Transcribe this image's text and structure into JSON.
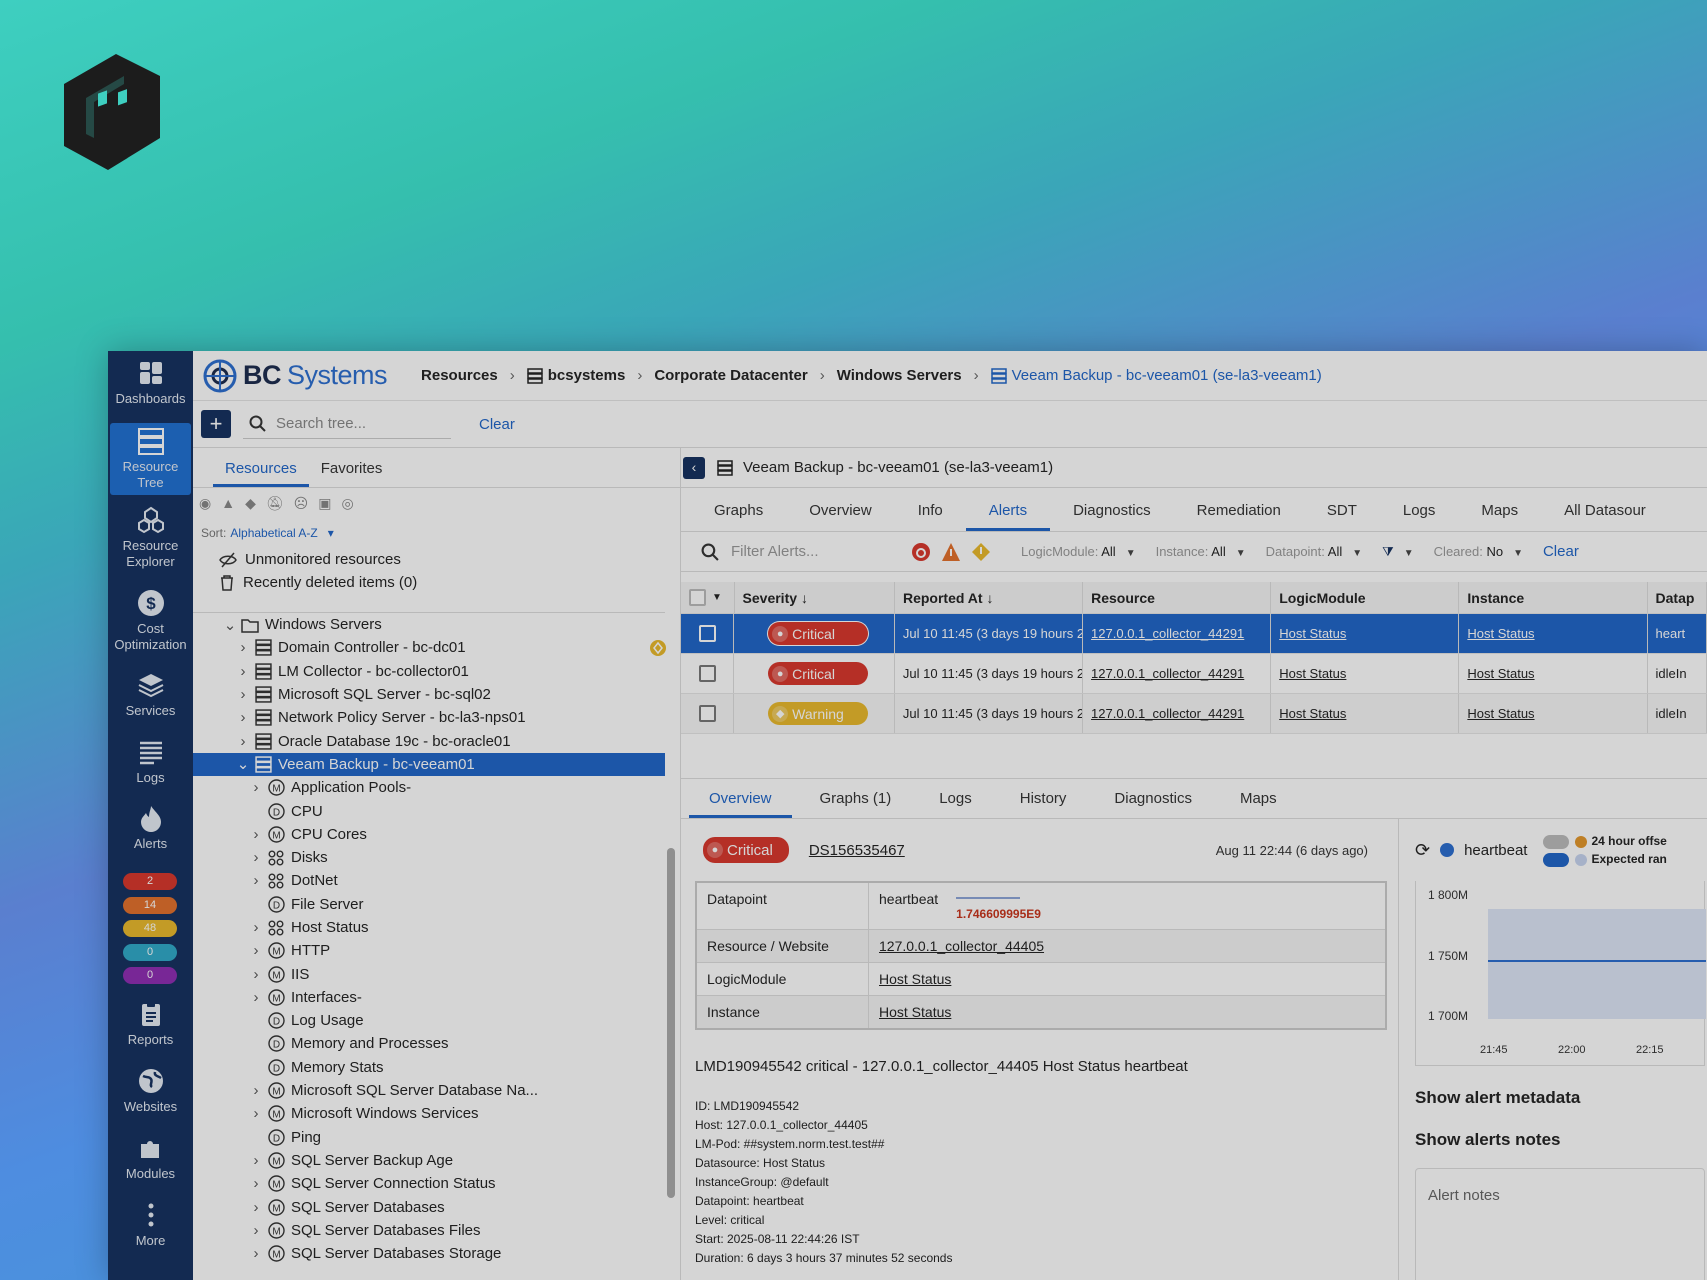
{
  "brand": {
    "name1": "BC",
    "name2": "Systems"
  },
  "breadcrumb": [
    "Resources",
    "bcsystems",
    "Corporate Datacenter",
    "Windows Servers",
    "Veeam Backup - bc-veeam01 (se-la3-veeam1)"
  ],
  "nav": [
    {
      "label": "Dashboards",
      "icon": "dashboard-icon"
    },
    {
      "label": "Resource Tree",
      "icon": "resource-tree-icon"
    },
    {
      "label": "Resource Explorer",
      "icon": "resource-explorer-icon"
    },
    {
      "label": "Cost Optimization",
      "icon": "dollar-icon"
    },
    {
      "label": "Services",
      "icon": "layers-icon"
    },
    {
      "label": "Logs",
      "icon": "logs-icon"
    },
    {
      "label": "Alerts",
      "icon": "flame-icon"
    },
    {
      "label": "Reports",
      "icon": "clipboard-icon"
    },
    {
      "label": "Websites",
      "icon": "globe-icon"
    },
    {
      "label": "Modules",
      "icon": "puzzle-icon"
    },
    {
      "label": "More",
      "icon": "more-vertical-icon"
    }
  ],
  "badges": [
    {
      "value": "2",
      "color": "#d8352a"
    },
    {
      "value": "14",
      "color": "#e3702a"
    },
    {
      "value": "48",
      "color": "#e9b92a"
    },
    {
      "value": "0",
      "color": "#2ea9c9"
    },
    {
      "value": "0",
      "color": "#8e2bb3"
    }
  ],
  "toolbar": {
    "search_placeholder": "Search tree...",
    "clear": "Clear"
  },
  "left_tabs": [
    "Resources",
    "Favorites"
  ],
  "sort": {
    "label": "Sort:",
    "value": "Alphabetical A-Z"
  },
  "special": [
    "Unmonitored resources",
    "Recently deleted items (0)"
  ],
  "tree": [
    {
      "label": "Windows Servers",
      "level": 0,
      "exp": "v",
      "icon": "folder"
    },
    {
      "label": "Domain Controller - bc-dc01",
      "level": 1,
      "exp": ">",
      "icon": "server",
      "badge": true
    },
    {
      "label": "LM Collector - bc-collector01",
      "level": 1,
      "exp": ">",
      "icon": "server"
    },
    {
      "label": "Microsoft SQL Server - bc-sql02",
      "level": 1,
      "exp": ">",
      "icon": "server"
    },
    {
      "label": "Network Policy Server - bc-la3-nps01",
      "level": 1,
      "exp": ">",
      "icon": "server"
    },
    {
      "label": "Oracle Database 19c - bc-oracle01",
      "level": 1,
      "exp": ">",
      "icon": "server"
    },
    {
      "label": "Veeam Backup - bc-veeam01",
      "level": 1,
      "exp": "v",
      "icon": "server",
      "sel": true
    },
    {
      "label": "Application Pools-",
      "level": 2,
      "exp": ">",
      "icon": "M"
    },
    {
      "label": "CPU",
      "level": 2,
      "exp": "",
      "icon": "D"
    },
    {
      "label": "CPU Cores",
      "level": 2,
      "exp": ">",
      "icon": "M"
    },
    {
      "label": "Disks",
      "level": 2,
      "exp": ">",
      "icon": "grid"
    },
    {
      "label": "DotNet",
      "level": 2,
      "exp": ">",
      "icon": "grid"
    },
    {
      "label": "File Server",
      "level": 2,
      "exp": "",
      "icon": "D"
    },
    {
      "label": "Host Status",
      "level": 2,
      "exp": ">",
      "icon": "grid"
    },
    {
      "label": "HTTP",
      "level": 2,
      "exp": ">",
      "icon": "M"
    },
    {
      "label": "IIS",
      "level": 2,
      "exp": ">",
      "icon": "M"
    },
    {
      "label": "Interfaces-",
      "level": 2,
      "exp": ">",
      "icon": "M"
    },
    {
      "label": "Log Usage",
      "level": 2,
      "exp": "",
      "icon": "D"
    },
    {
      "label": "Memory and Processes",
      "level": 2,
      "exp": "",
      "icon": "D"
    },
    {
      "label": "Memory Stats",
      "level": 2,
      "exp": "",
      "icon": "D"
    },
    {
      "label": "Microsoft SQL Server Database Na...",
      "level": 2,
      "exp": ">",
      "icon": "M"
    },
    {
      "label": "Microsoft Windows Services",
      "level": 2,
      "exp": ">",
      "icon": "M"
    },
    {
      "label": "Ping",
      "level": 2,
      "exp": "",
      "icon": "D"
    },
    {
      "label": "SQL Server Backup Age",
      "level": 2,
      "exp": ">",
      "icon": "M"
    },
    {
      "label": "SQL Server Connection Status",
      "level": 2,
      "exp": ">",
      "icon": "M"
    },
    {
      "label": "SQL Server Databases",
      "level": 2,
      "exp": ">",
      "icon": "M"
    },
    {
      "label": "SQL Server Databases Files",
      "level": 2,
      "exp": ">",
      "icon": "M"
    },
    {
      "label": "SQL Server Databases Storage",
      "level": 2,
      "exp": ">",
      "icon": "M"
    }
  ],
  "resource_title": "Veeam Backup - bc-veeam01 (se-la3-veeam1)",
  "resource_tabs": [
    "Graphs",
    "Overview",
    "Info",
    "Alerts",
    "Diagnostics",
    "Remediation",
    "SDT",
    "Logs",
    "Maps",
    "All Datasour"
  ],
  "alert_filter": {
    "placeholder": "Filter Alerts...",
    "logicmodule_label": "LogicModule:",
    "logicmodule": "All",
    "instance_label": "Instance:",
    "instance": "All",
    "datapoint_label": "Datapoint:",
    "datapoint": "All",
    "cleared_label": "Cleared:",
    "cleared": "No",
    "clear": "Clear"
  },
  "alert_columns": [
    "Severity",
    "Reported At",
    "Resource",
    "LogicModule",
    "Instance",
    "Datap"
  ],
  "alerts": [
    {
      "severity": "Critical",
      "reported": "Jul 10 11:45  (3 days 19 hours 2",
      "resource": "127.0.0.1_collector_44291",
      "module": "Host Status",
      "instance": "Host Status",
      "datapoint": "heart"
    },
    {
      "severity": "Critical",
      "reported": "Jul 10 11:45  (3 days 19 hours 2",
      "resource": "127.0.0.1_collector_44291",
      "module": "Host Status",
      "instance": "Host Status",
      "datapoint": "idleIn"
    },
    {
      "severity": "Warning",
      "reported": "Jul 10 11:45  (3 days 19 hours 2",
      "resource": "127.0.0.1_collector_44291",
      "module": "Host Status",
      "instance": "Host Status",
      "datapoint": "idleIn"
    }
  ],
  "detail_tabs": [
    "Overview",
    "Graphs (1)",
    "Logs",
    "History",
    "Diagnostics",
    "Maps"
  ],
  "detail": {
    "severity": "Critical",
    "ds": "DS156535467",
    "when": "Aug 11 22:44  (6 days ago)",
    "rows": [
      {
        "k": "Datapoint",
        "v": "heartbeat"
      },
      {
        "k": "Resource / Website",
        "v": "127.0.0.1_collector_44405"
      },
      {
        "k": "LogicModule",
        "v": "Host Status"
      },
      {
        "k": "Instance",
        "v": "Host Status"
      }
    ],
    "spark_value": "1.746609995E9",
    "message": "LMD190945542 critical - 127.0.0.1_collector_44405 Host Status heartbeat",
    "meta": [
      "ID: LMD190945542",
      "Host: 127.0.0.1_collector_44405",
      "LM-Pod: ##system.norm.test.test##",
      "Datasource: Host Status",
      "InstanceGroup: @default",
      "Datapoint: heartbeat",
      "Level: critical",
      "Start: 2025-08-11 22:44:26 IST",
      "Duration: 6 days 3 hours 37 minutes 52 seconds"
    ]
  },
  "graph": {
    "series": "heartbeat",
    "toggle1": "24 hour offse",
    "toggle2": "Expected ran",
    "yticks": [
      "1 800M",
      "1 750M",
      "1 700M"
    ],
    "xticks": [
      "21:45",
      "22:00",
      "22:15"
    ],
    "show_meta": "Show alert metadata",
    "show_notes": "Show alerts notes",
    "notes_placeholder": "Alert notes"
  },
  "colors": {
    "nav_bg": "#132f5f",
    "accent": "#1e64c8",
    "critical": "#d8352a",
    "warning": "#e9b92a"
  }
}
